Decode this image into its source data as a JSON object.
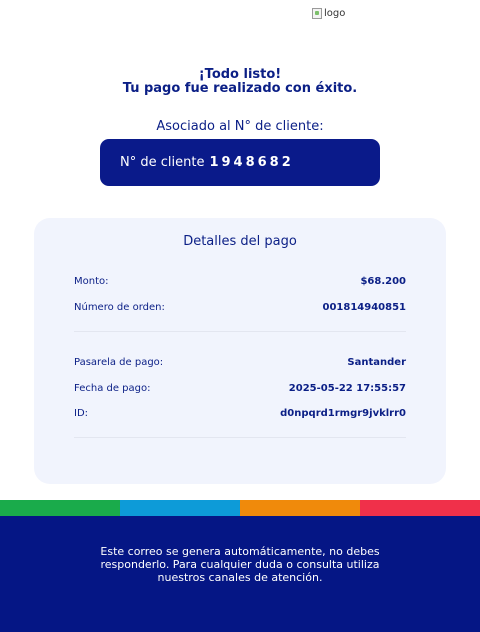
{
  "header": {
    "logo_alt": "logo",
    "icon": "broken-image-icon"
  },
  "success": {
    "line1": "¡Todo listo!",
    "line2": "Tu pago fue realizado con éxito."
  },
  "client": {
    "associated_label": "Asociado al N° de cliente:",
    "prefix": "N° de cliente",
    "number": "1948682"
  },
  "details": {
    "title": "Detalles del pago",
    "amount": {
      "label": "Monto:",
      "value": "$68.200"
    },
    "order": {
      "label": "Número de orden:",
      "value": "001814940851"
    },
    "gateway": {
      "label": "Pasarela de pago:",
      "value": "Santander"
    },
    "date": {
      "label": "Fecha de pago:",
      "value": "2025-05-22 17:55:57"
    },
    "id": {
      "label": "ID:",
      "value": "d0npqrd1rmgr9jvklrr0"
    }
  },
  "colors": {
    "primary": "#0b1f86",
    "stripe_green": "#1aab4b",
    "stripe_blue": "#0d9bd8",
    "stripe_orange": "#f08a0b",
    "stripe_red": "#f0304a"
  },
  "footer": {
    "text": "Este correo se genera automáticamente, no debes responderlo. Para cualquier duda o consulta utiliza nuestros canales de atención."
  }
}
